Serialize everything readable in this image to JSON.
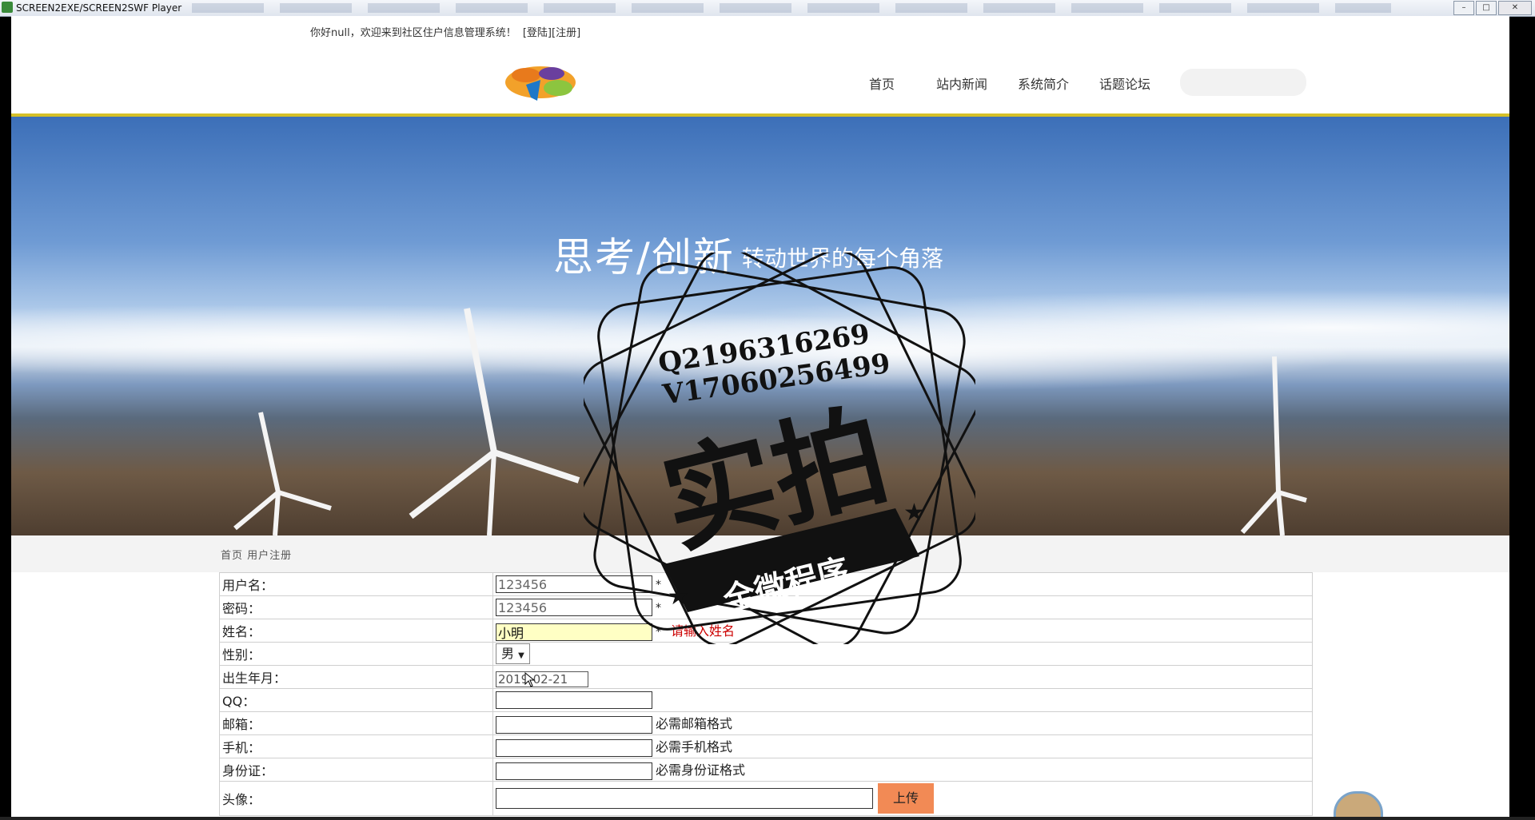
{
  "window": {
    "title": "SCREEN2EXE/SCREEN2SWF Player"
  },
  "header": {
    "welcome_text": "你好null，欢迎来到社区住户信息管理系统！",
    "login_link": "[登陆]",
    "register_link": "[注册]",
    "nav": [
      "首页",
      "站内新闻",
      "系统简介",
      "话题论坛"
    ],
    "search_placeholder": ""
  },
  "banner": {
    "slogan_main": "思考/创新",
    "slogan_sub": "转动世界的每个角落"
  },
  "watermark": {
    "line1": "Q2196316269",
    "line2": "V17060256499",
    "main": "实拍",
    "ribbon": "全微程序"
  },
  "breadcrumb": "首页 用户注册",
  "form": {
    "username_label": "用户名：",
    "username_value": "123456",
    "password_label": "密码：",
    "password_value": "123456",
    "name_label": "姓名：",
    "name_value": "小明",
    "name_error": "请输入姓名",
    "gender_label": "性别：",
    "gender_value": "男",
    "birth_label": "出生年月：",
    "birth_value": "2019-02-21",
    "qq_label": "QQ：",
    "email_label": "邮箱：",
    "email_hint": "必需邮箱格式",
    "phone_label": "手机：",
    "phone_hint": "必需手机格式",
    "id_label": "身份证：",
    "id_hint": "必需身份证格式",
    "avatar_label": "头像：",
    "upload_label": "上传",
    "required_mark": "*"
  }
}
